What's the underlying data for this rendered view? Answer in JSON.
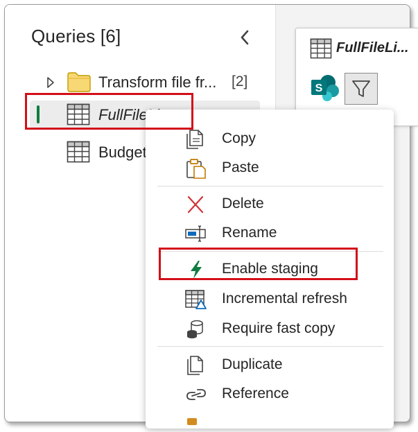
{
  "queries_pane": {
    "title": "Queries [6]",
    "items": [
      {
        "label": "Transform file fr...",
        "count": "[2]",
        "type": "folder"
      },
      {
        "label": "FullFileList",
        "type": "table",
        "selected": true
      },
      {
        "label": "Budget",
        "type": "table"
      }
    ]
  },
  "preview": {
    "title": "FullFileLi..."
  },
  "context_menu": {
    "items": [
      {
        "label": "Copy",
        "icon": "copy-icon"
      },
      {
        "label": "Paste",
        "icon": "paste-icon"
      },
      {
        "label": "Delete",
        "icon": "delete-icon"
      },
      {
        "label": "Rename",
        "icon": "rename-icon"
      },
      {
        "label": "Enable staging",
        "icon": "lightning-icon"
      },
      {
        "label": "Incremental refresh",
        "icon": "incremental-refresh-icon"
      },
      {
        "label": "Require fast copy",
        "icon": "database-icon"
      },
      {
        "label": "Duplicate",
        "icon": "duplicate-icon"
      },
      {
        "label": "Reference",
        "icon": "link-icon"
      }
    ]
  },
  "colors": {
    "highlight": "#d20f19",
    "selection_bar": "#107c41",
    "staging_icon": "#107c41",
    "delete_icon": "#d13438",
    "folder": "#f8d775"
  }
}
